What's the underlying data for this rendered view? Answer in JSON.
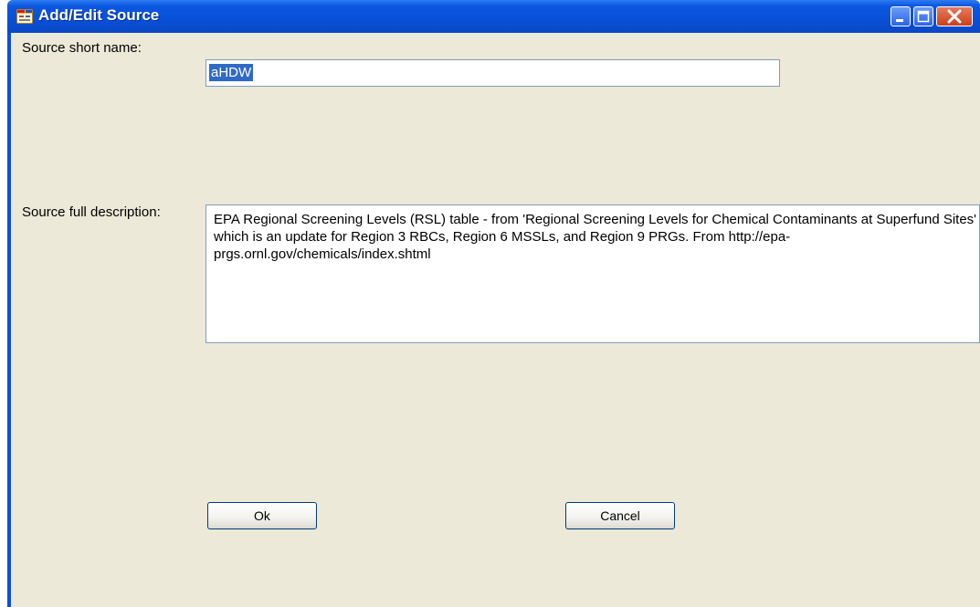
{
  "window": {
    "title": "Add/Edit Source",
    "controls": {
      "minimize": "minimize-icon",
      "maximize": "maximize-icon",
      "close": "close-icon"
    }
  },
  "form": {
    "short_name_label": "Source short name:",
    "short_name_value": "aHDW",
    "description_label": "Source full description:",
    "description_value": "EPA Regional Screening Levels (RSL) table - from 'Regional Screening Levels for Chemical Contaminants at Superfund Sites' which is an update for Region 3 RBCs, Region 6 MSSLs, and Region 9 PRGs.  From http://epa-prgs.ornl.gov/chemicals/index.shtml"
  },
  "buttons": {
    "ok_label": "Ok",
    "cancel_label": "Cancel"
  },
  "colors": {
    "titlebar": "#0950d8",
    "client_background": "#ece9d8",
    "selection": "#316ac5",
    "close_button": "#c8401c"
  }
}
